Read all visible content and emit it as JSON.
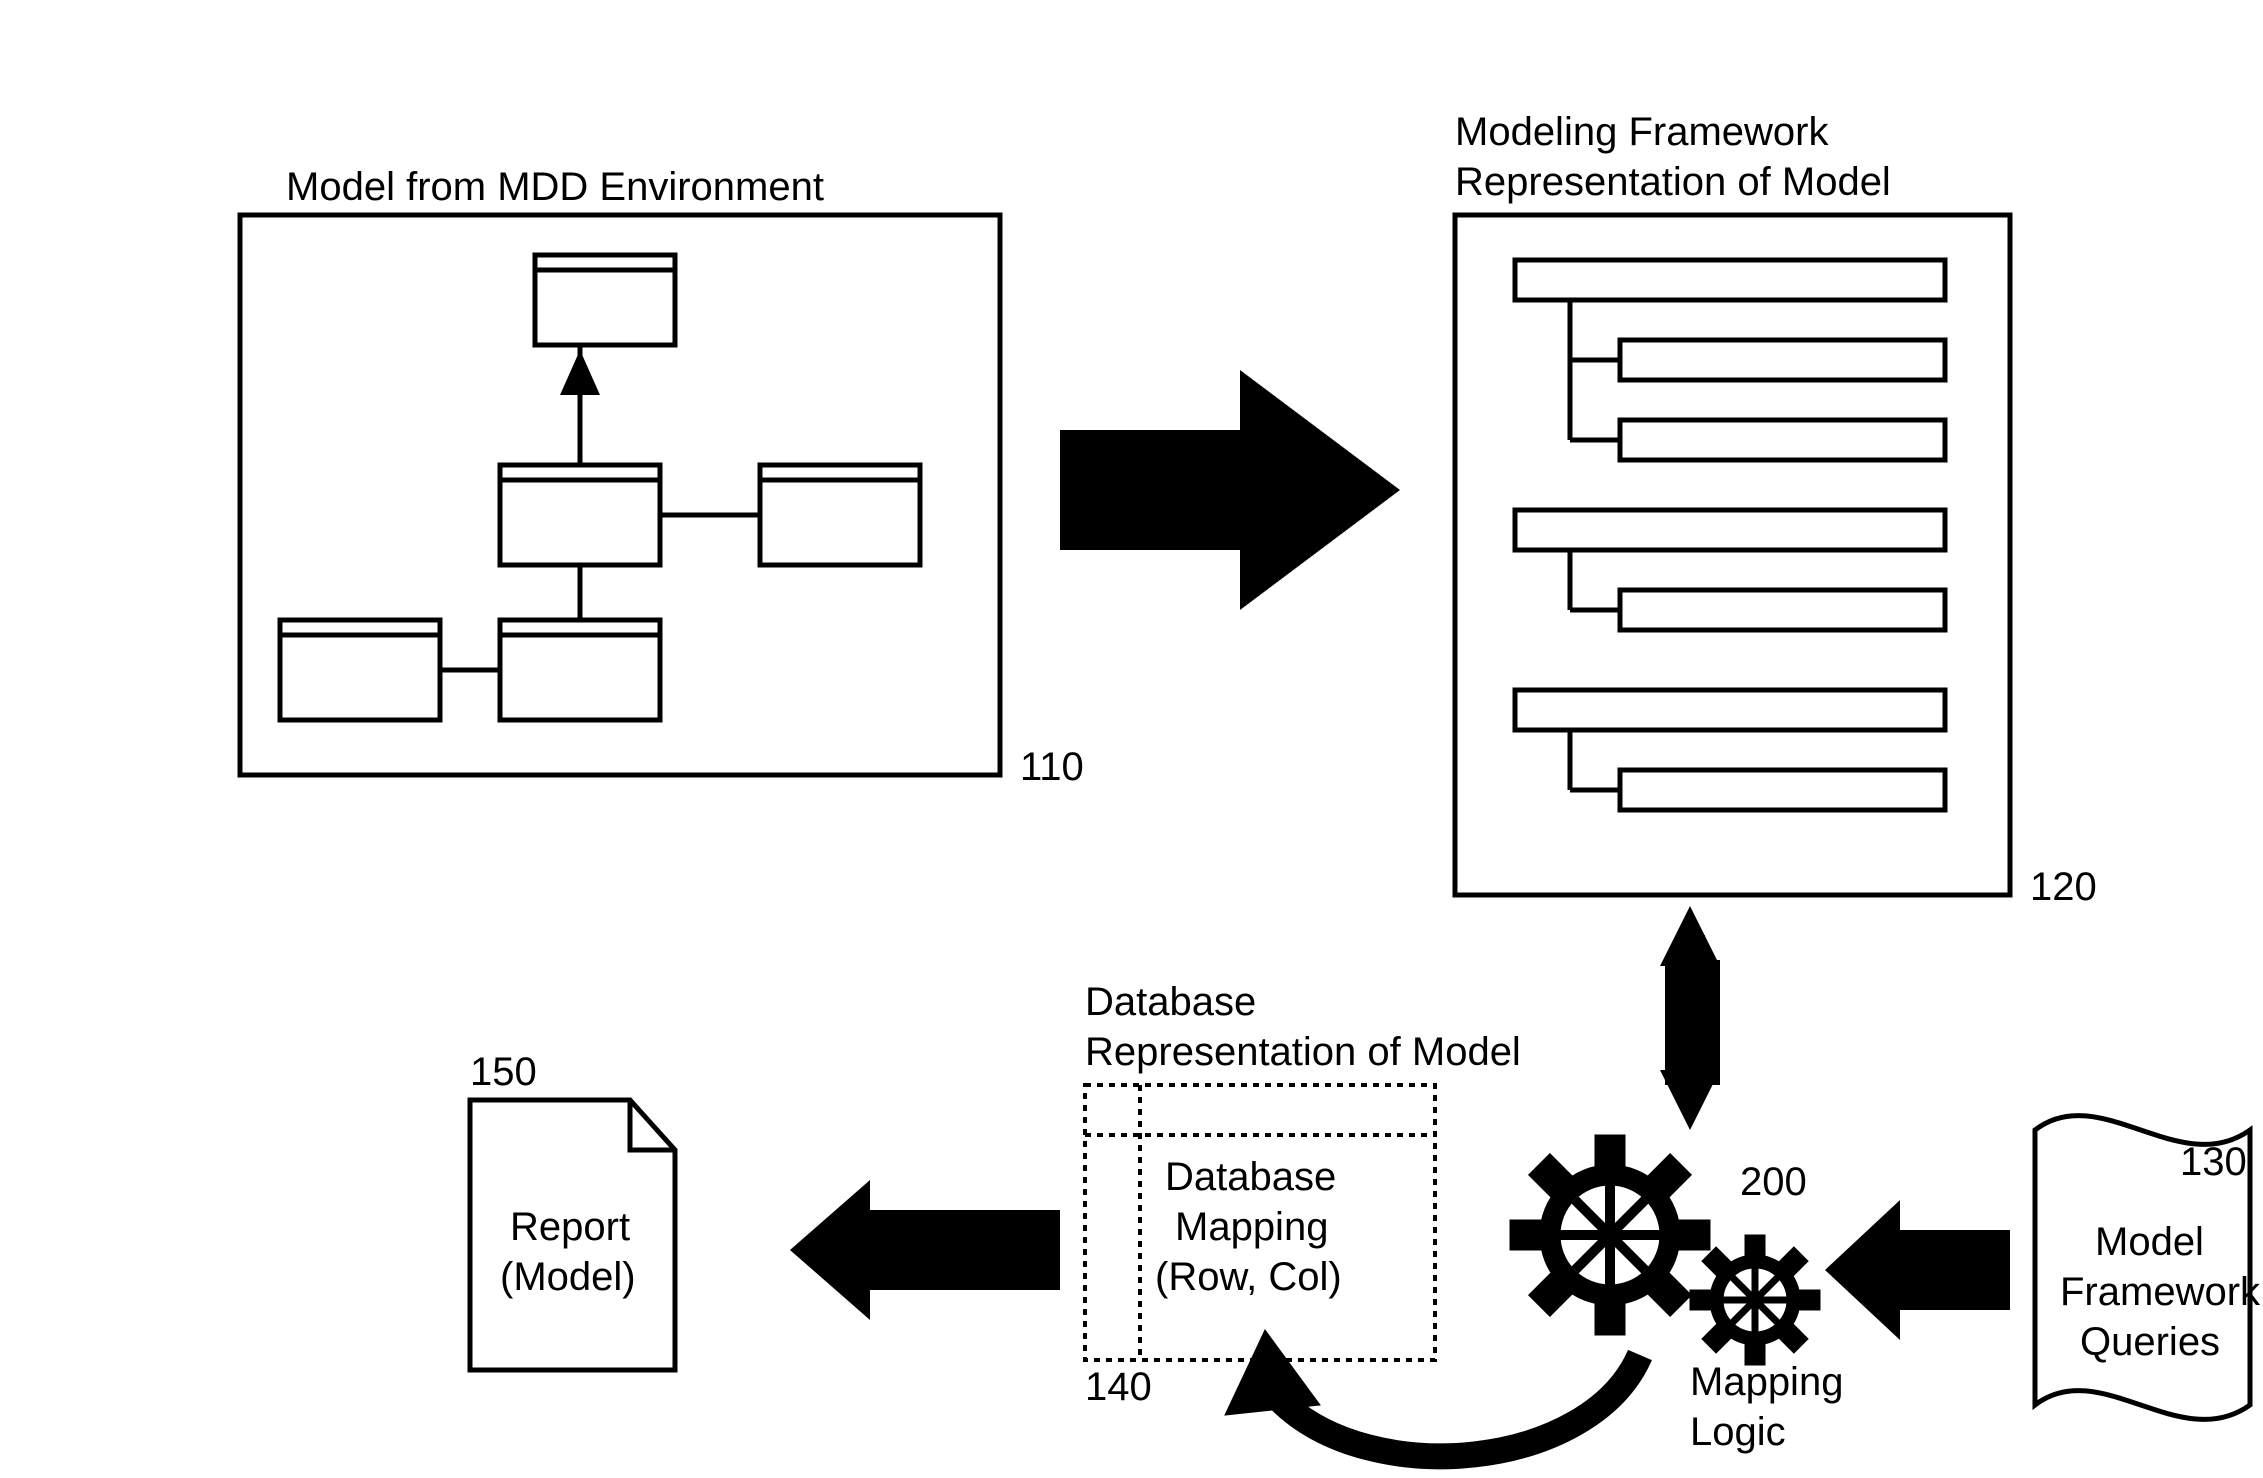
{
  "labels": {
    "mdd_title": "Model from MDD Environment",
    "mdd_ref": "110",
    "framework_title1": "Modeling Framework",
    "framework_title2": "Representation of Model",
    "framework_ref": "120",
    "db_title1": "Database",
    "db_title2": "Representation of Model",
    "db_cell1": "Database",
    "db_cell2": "Mapping",
    "db_cell3": "(Row, Col)",
    "db_ref": "140",
    "report_ref": "150",
    "report1": "Report",
    "report2": "(Model)",
    "mapping_ref": "200",
    "mapping1": "Mapping",
    "mapping2": "Logic",
    "queries_ref": "130",
    "queries1": "Model",
    "queries2": "Framework",
    "queries3": "Queries"
  }
}
